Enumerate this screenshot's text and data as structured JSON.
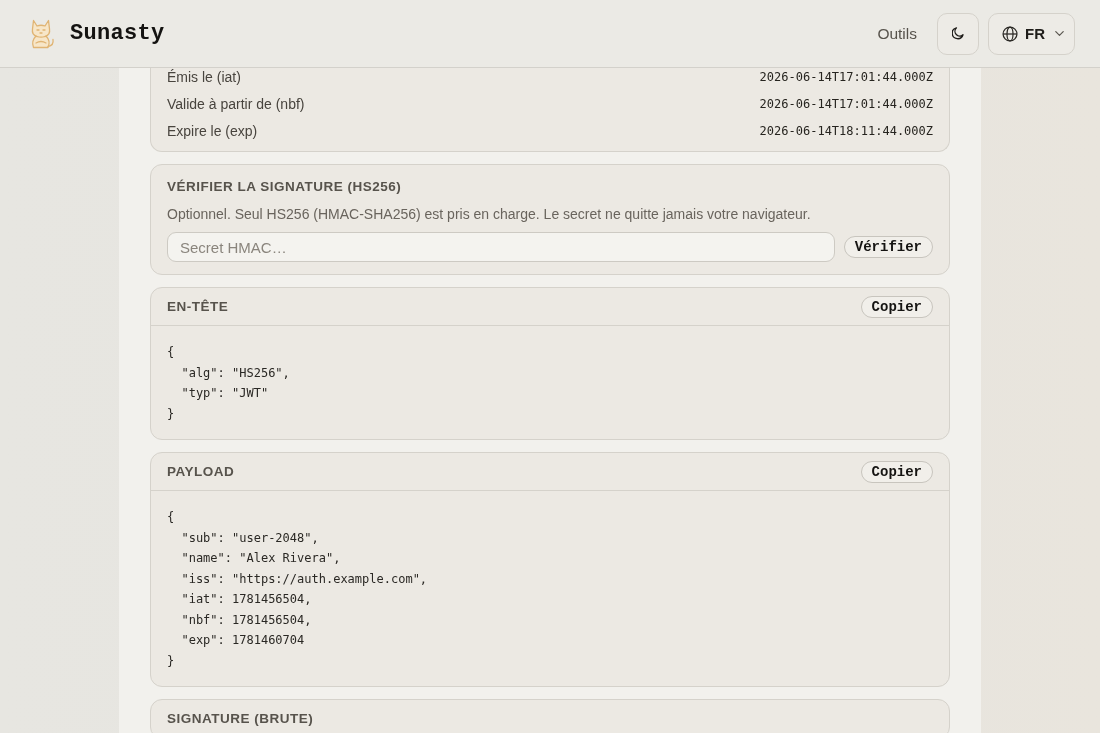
{
  "header": {
    "brand": "Sunasty",
    "nav": [
      {
        "label": "Outils"
      }
    ],
    "language": "FR"
  },
  "claims": [
    {
      "label": "Émis le (iat)",
      "value": "2026-06-14T17:01:44.000Z"
    },
    {
      "label": "Valide à partir de (nbf)",
      "value": "2026-06-14T17:01:44.000Z"
    },
    {
      "label": "Expire le (exp)",
      "value": "2026-06-14T18:11:44.000Z"
    }
  ],
  "verify": {
    "title": "VÉRIFIER LA SIGNATURE (HS256)",
    "description": "Optionnel. Seul HS256 (HMAC-SHA256) est pris en charge. Le secret ne quitte jamais votre navigateur.",
    "placeholder": "Secret HMAC…",
    "button": "Vérifier"
  },
  "sections": [
    {
      "title": "EN-TÊTE",
      "button": "Copier",
      "lines": [
        "{",
        "  \"alg\": \"HS256\",",
        "  \"typ\": \"JWT\"",
        "}"
      ]
    },
    {
      "title": "PAYLOAD",
      "button": "Copier",
      "lines": [
        "{",
        "  \"sub\": \"user-2048\",",
        "  \"name\": \"Alex Rivera\",",
        "  \"iss\": \"https://auth.example.com\",",
        "  \"iat\": 1781456504,",
        "  \"nbf\": 1781456504,",
        "  \"exp\": 1781460704",
        "}"
      ]
    },
    {
      "title": "SIGNATURE (BRUTE)"
    }
  ]
}
